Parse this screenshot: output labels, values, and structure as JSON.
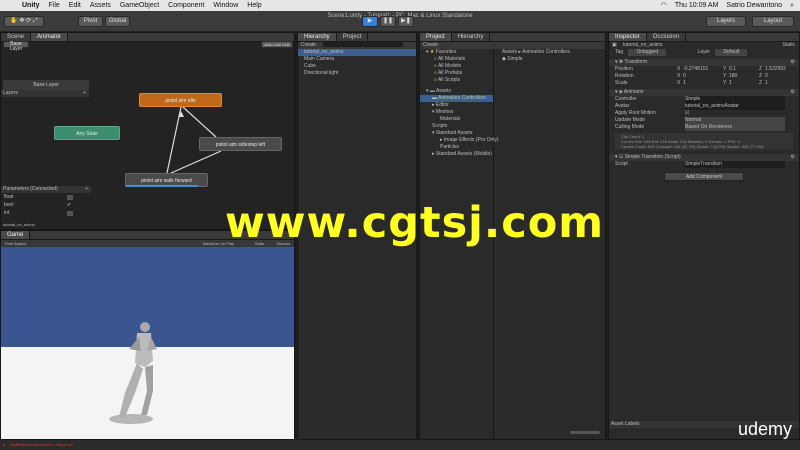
{
  "menubar": {
    "app": "Unity",
    "items": [
      "File",
      "Edit",
      "Assets",
      "GameObject",
      "Component",
      "Window",
      "Help"
    ],
    "clock": "Thu 10:09 AM",
    "user": "Satrio Dewantono"
  },
  "window_title": "Scene1.unity - Tutorial1 - PC, Mac & Linux Standalone",
  "toolbar": {
    "pivot": "Pivot",
    "global": "Global",
    "layers": "Layers",
    "layout": "Layout"
  },
  "animator": {
    "tabs": [
      "Scene",
      "Animator"
    ],
    "base_layer_btn": "Base Layer",
    "auto_live_link": "Auto Live Link",
    "layer_name": "Base Layer",
    "layers_label": "Layers",
    "params_label": "Parameters (Connected)",
    "params": [
      "float",
      "bool",
      "int"
    ],
    "footer": "tutorial_no_anims",
    "nodes": {
      "idle": "pistol aim idle",
      "any": "Any State",
      "sidestep": "pistol aim sidestep left",
      "walk": "pistol aim walk forward"
    }
  },
  "hierarchy": {
    "tabs": [
      "Hierarchy",
      "Project"
    ],
    "create": "Create",
    "items": [
      "tutorial_no_anims",
      "Main Camera",
      "Cube",
      "Directional light"
    ]
  },
  "project": {
    "tabs": [
      "Project",
      "Hierarchy"
    ],
    "create": "Create",
    "favorites_label": "Favorites",
    "favorites": [
      "All Materials",
      "All Models",
      "All Prefabs",
      "All Scripts"
    ],
    "assets_label": "Assets",
    "assets": [
      "Animation Controllers",
      "Editor",
      "Meshes",
      "Materials",
      "Scripts",
      "Standard Assets",
      "Image Effects (Pro Only)",
      "Particles",
      "Standard Assets (Mobile)"
    ],
    "breadcrumb": "Assets ▸ Animation Controllers",
    "file": "Simple"
  },
  "inspector": {
    "tabs": [
      "Inspector",
      "Occlusion"
    ],
    "object_name": "tutorial_no_anims",
    "static": "Static",
    "tag_label": "Tag",
    "tag_value": "Untagged",
    "layer_label": "Layer",
    "layer_value": "Default",
    "transform": {
      "title": "Transform",
      "position": [
        "-0.2748151",
        "0.1",
        "1.532992"
      ],
      "rotation": [
        "0",
        "180",
        "0"
      ],
      "scale": [
        "1",
        "1",
        "1"
      ],
      "labels": [
        "Position",
        "Rotation",
        "Scale"
      ]
    },
    "animator": {
      "title": "Animator",
      "controller_label": "Controller",
      "controller_value": "Simple",
      "avatar_label": "Avatar",
      "avatar_value": "tutorial_no_animsAvatar",
      "root_motion_label": "Apply Root Motion",
      "update_label": "Update Mode",
      "update_value": "Normal",
      "culling_label": "Culling Mode",
      "culling_value": "Based On Renderers",
      "info1": "Clip Count: 1",
      "info2": "Curves Pos: 216 Rot: 216 Scale: 216 Muscles: 0 Generic: 0 PPtr: 0",
      "info3": "Curves Count: 810 Constant: 184 (22.7%) Dense: 0 (0.0%) Stream: 626 (77.3%)"
    },
    "script_component": {
      "title": "Simple Transition (Script)",
      "label": "Script",
      "value": "SimpleTransition"
    },
    "add_component": "Add Component",
    "asset_labels": "Asset Labels"
  },
  "game": {
    "tab": "Game",
    "aspect": "Free Aspect",
    "maximize": "Maximize on Play",
    "stats": "Stats",
    "gizmos": "Gizmos"
  },
  "status_message": "NullReferenceException: Object ref...",
  "watermark": "www.cgtsj.com",
  "brand": "udemy",
  "colors": {
    "idle_node": "#c0681a",
    "any_node": "#3c8c6e",
    "walk_progress": "#3f8fd8",
    "sky": "#3b5590",
    "ground": "#f4f4f4",
    "watermark": "#ffff22",
    "error": "#e03a3a"
  }
}
